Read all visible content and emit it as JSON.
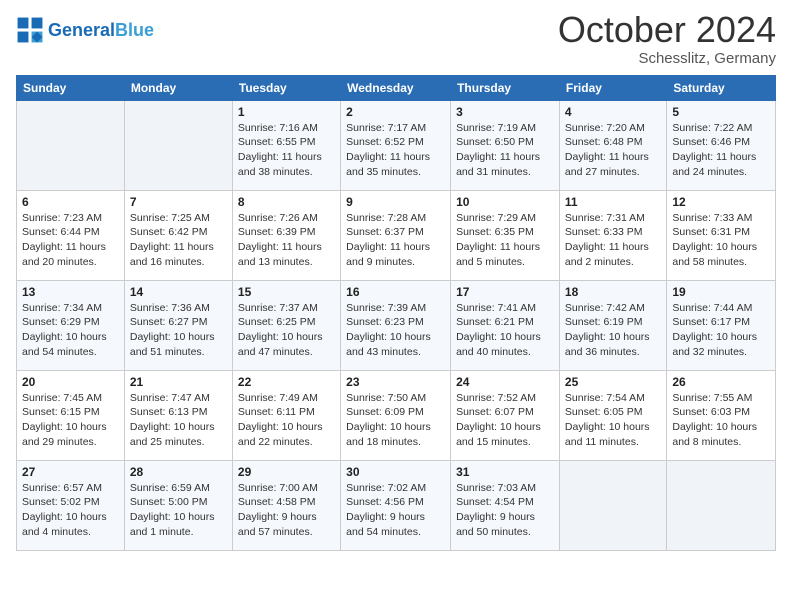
{
  "header": {
    "logo_general": "General",
    "logo_blue": "Blue",
    "month": "October 2024",
    "location": "Schesslitz, Germany"
  },
  "days_of_week": [
    "Sunday",
    "Monday",
    "Tuesday",
    "Wednesday",
    "Thursday",
    "Friday",
    "Saturday"
  ],
  "weeks": [
    [
      {
        "day": "",
        "info": ""
      },
      {
        "day": "",
        "info": ""
      },
      {
        "day": "1",
        "info": "Sunrise: 7:16 AM\nSunset: 6:55 PM\nDaylight: 11 hours and 38 minutes."
      },
      {
        "day": "2",
        "info": "Sunrise: 7:17 AM\nSunset: 6:52 PM\nDaylight: 11 hours and 35 minutes."
      },
      {
        "day": "3",
        "info": "Sunrise: 7:19 AM\nSunset: 6:50 PM\nDaylight: 11 hours and 31 minutes."
      },
      {
        "day": "4",
        "info": "Sunrise: 7:20 AM\nSunset: 6:48 PM\nDaylight: 11 hours and 27 minutes."
      },
      {
        "day": "5",
        "info": "Sunrise: 7:22 AM\nSunset: 6:46 PM\nDaylight: 11 hours and 24 minutes."
      }
    ],
    [
      {
        "day": "6",
        "info": "Sunrise: 7:23 AM\nSunset: 6:44 PM\nDaylight: 11 hours and 20 minutes."
      },
      {
        "day": "7",
        "info": "Sunrise: 7:25 AM\nSunset: 6:42 PM\nDaylight: 11 hours and 16 minutes."
      },
      {
        "day": "8",
        "info": "Sunrise: 7:26 AM\nSunset: 6:39 PM\nDaylight: 11 hours and 13 minutes."
      },
      {
        "day": "9",
        "info": "Sunrise: 7:28 AM\nSunset: 6:37 PM\nDaylight: 11 hours and 9 minutes."
      },
      {
        "day": "10",
        "info": "Sunrise: 7:29 AM\nSunset: 6:35 PM\nDaylight: 11 hours and 5 minutes."
      },
      {
        "day": "11",
        "info": "Sunrise: 7:31 AM\nSunset: 6:33 PM\nDaylight: 11 hours and 2 minutes."
      },
      {
        "day": "12",
        "info": "Sunrise: 7:33 AM\nSunset: 6:31 PM\nDaylight: 10 hours and 58 minutes."
      }
    ],
    [
      {
        "day": "13",
        "info": "Sunrise: 7:34 AM\nSunset: 6:29 PM\nDaylight: 10 hours and 54 minutes."
      },
      {
        "day": "14",
        "info": "Sunrise: 7:36 AM\nSunset: 6:27 PM\nDaylight: 10 hours and 51 minutes."
      },
      {
        "day": "15",
        "info": "Sunrise: 7:37 AM\nSunset: 6:25 PM\nDaylight: 10 hours and 47 minutes."
      },
      {
        "day": "16",
        "info": "Sunrise: 7:39 AM\nSunset: 6:23 PM\nDaylight: 10 hours and 43 minutes."
      },
      {
        "day": "17",
        "info": "Sunrise: 7:41 AM\nSunset: 6:21 PM\nDaylight: 10 hours and 40 minutes."
      },
      {
        "day": "18",
        "info": "Sunrise: 7:42 AM\nSunset: 6:19 PM\nDaylight: 10 hours and 36 minutes."
      },
      {
        "day": "19",
        "info": "Sunrise: 7:44 AM\nSunset: 6:17 PM\nDaylight: 10 hours and 32 minutes."
      }
    ],
    [
      {
        "day": "20",
        "info": "Sunrise: 7:45 AM\nSunset: 6:15 PM\nDaylight: 10 hours and 29 minutes."
      },
      {
        "day": "21",
        "info": "Sunrise: 7:47 AM\nSunset: 6:13 PM\nDaylight: 10 hours and 25 minutes."
      },
      {
        "day": "22",
        "info": "Sunrise: 7:49 AM\nSunset: 6:11 PM\nDaylight: 10 hours and 22 minutes."
      },
      {
        "day": "23",
        "info": "Sunrise: 7:50 AM\nSunset: 6:09 PM\nDaylight: 10 hours and 18 minutes."
      },
      {
        "day": "24",
        "info": "Sunrise: 7:52 AM\nSunset: 6:07 PM\nDaylight: 10 hours and 15 minutes."
      },
      {
        "day": "25",
        "info": "Sunrise: 7:54 AM\nSunset: 6:05 PM\nDaylight: 10 hours and 11 minutes."
      },
      {
        "day": "26",
        "info": "Sunrise: 7:55 AM\nSunset: 6:03 PM\nDaylight: 10 hours and 8 minutes."
      }
    ],
    [
      {
        "day": "27",
        "info": "Sunrise: 6:57 AM\nSunset: 5:02 PM\nDaylight: 10 hours and 4 minutes."
      },
      {
        "day": "28",
        "info": "Sunrise: 6:59 AM\nSunset: 5:00 PM\nDaylight: 10 hours and 1 minute."
      },
      {
        "day": "29",
        "info": "Sunrise: 7:00 AM\nSunset: 4:58 PM\nDaylight: 9 hours and 57 minutes."
      },
      {
        "day": "30",
        "info": "Sunrise: 7:02 AM\nSunset: 4:56 PM\nDaylight: 9 hours and 54 minutes."
      },
      {
        "day": "31",
        "info": "Sunrise: 7:03 AM\nSunset: 4:54 PM\nDaylight: 9 hours and 50 minutes."
      },
      {
        "day": "",
        "info": ""
      },
      {
        "day": "",
        "info": ""
      }
    ]
  ]
}
